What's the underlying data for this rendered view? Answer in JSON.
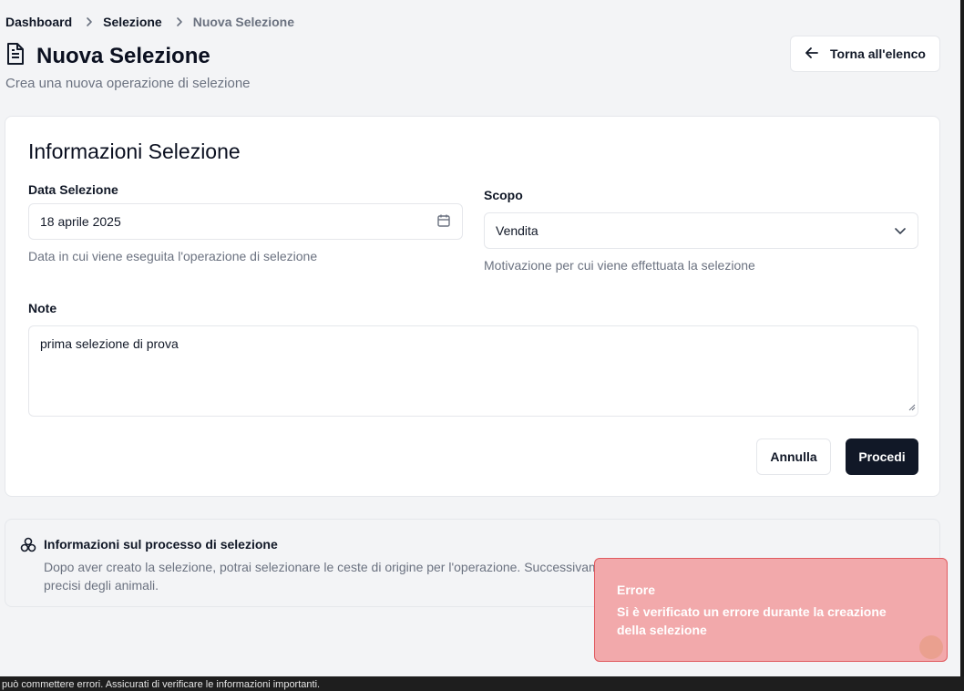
{
  "breadcrumb": {
    "items": [
      "Dashboard",
      "Selezione",
      "Nuova Selezione"
    ]
  },
  "header": {
    "title": "Nuova Selezione",
    "subtitle": "Crea una nuova operazione di selezione",
    "back_label": "Torna all'elenco"
  },
  "form": {
    "card_title": "Informazioni Selezione",
    "date": {
      "label": "Data Selezione",
      "value": "18 aprile 2025",
      "hint": "Data in cui viene eseguita l'operazione di selezione"
    },
    "scope": {
      "label": "Scopo",
      "value": "Vendita",
      "hint": "Motivazione per cui viene effettuata la selezione"
    },
    "notes": {
      "label": "Note",
      "value": "prima selezione di prova"
    },
    "cancel_label": "Annulla",
    "proceed_label": "Procedi"
  },
  "info": {
    "title": "Informazioni sul processo di selezione",
    "text_line1": "Dopo aver creato la selezione, potrai selezionare le ceste di origine per l'operazione. Successivame",
    "text_line2": "precisi degli animali."
  },
  "toast": {
    "title": "Errore",
    "message": "Si è verificato un errore durante la creazione della selezione"
  },
  "footer_strip": "può commettere errori. Assicurati di verificare le informazioni importanti.",
  "colors": {
    "primary": "#111827",
    "toast_bg": "#f2a9ab",
    "toast_border": "#e05a5f"
  }
}
